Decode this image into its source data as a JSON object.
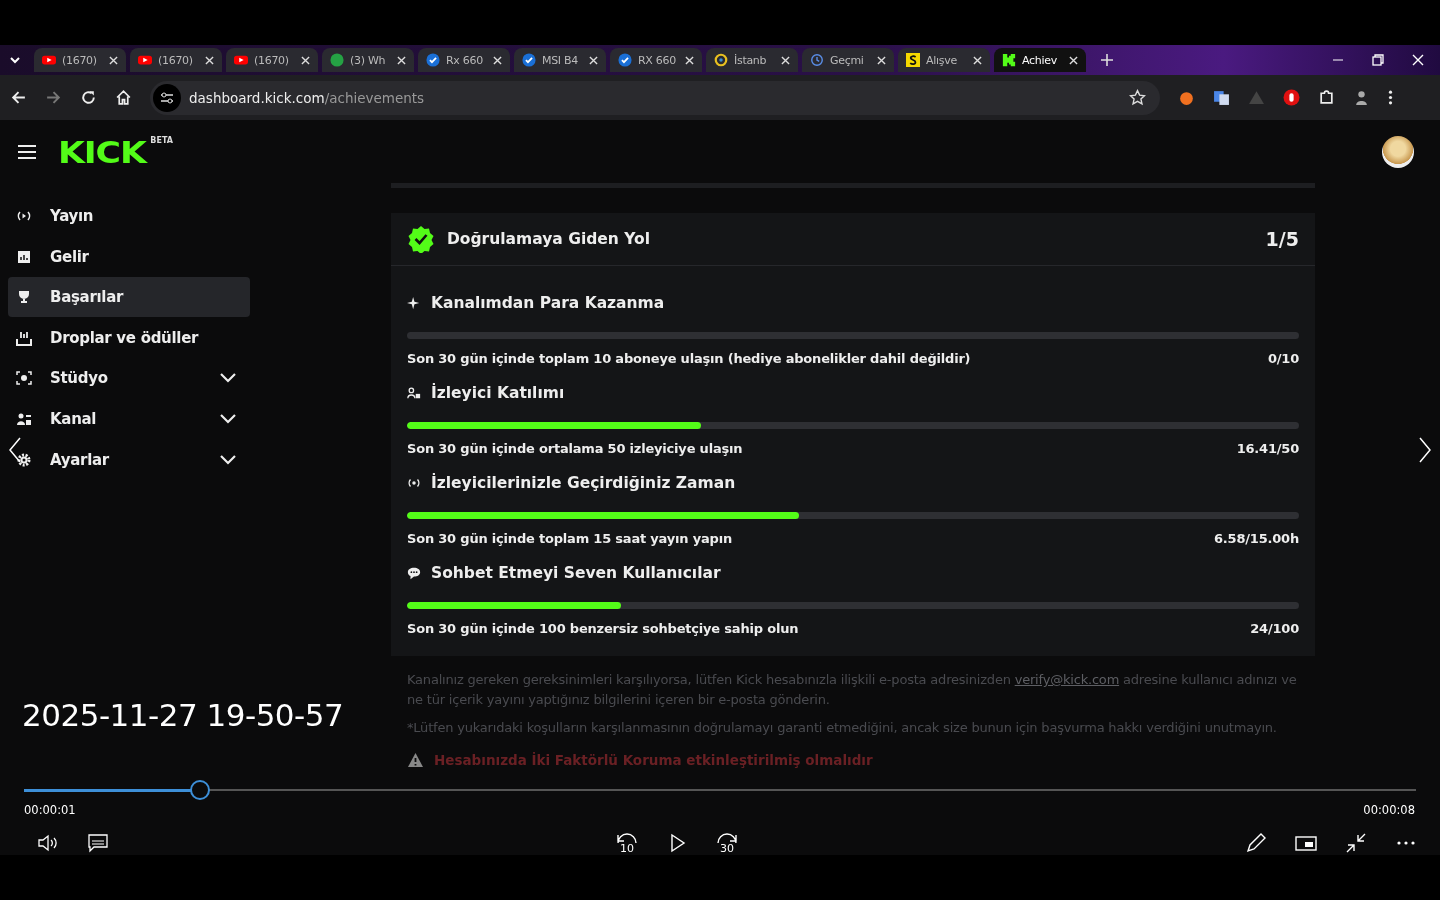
{
  "browser": {
    "tabs": [
      {
        "kind": "youtube",
        "label": "(1670)",
        "selected": false
      },
      {
        "kind": "youtube",
        "label": "(1670)",
        "selected": false
      },
      {
        "kind": "youtube",
        "label": "(1670)",
        "selected": false
      },
      {
        "kind": "whatsapp",
        "label": "(3) Wh",
        "selected": false
      },
      {
        "kind": "check",
        "label": "Rx 660",
        "selected": false
      },
      {
        "kind": "check",
        "label": "MSI B4",
        "selected": false
      },
      {
        "kind": "check",
        "label": "RX 660",
        "selected": false
      },
      {
        "kind": "ring",
        "label": "İstanb",
        "selected": false
      },
      {
        "kind": "history",
        "label": "Geçmi",
        "selected": false
      },
      {
        "kind": "s",
        "label": "Alışve",
        "selected": false
      },
      {
        "kind": "kick",
        "label": "Achiev",
        "selected": true
      }
    ],
    "url_host": "dashboard.kick.com",
    "url_path": "/achievements"
  },
  "logo": {
    "text": "KICK",
    "badge": "BETA"
  },
  "sidebar": {
    "items": [
      {
        "kind": "broadcast",
        "label": "Yayın",
        "selected": false,
        "expandable": false
      },
      {
        "kind": "chart",
        "label": "Gelir",
        "selected": false,
        "expandable": false
      },
      {
        "kind": "trophy",
        "label": "Başarılar",
        "selected": true,
        "expandable": false
      },
      {
        "kind": "drops",
        "label": "Droplar ve ödüller",
        "selected": false,
        "expandable": false
      },
      {
        "kind": "studio",
        "label": "Stüdyo",
        "selected": false,
        "expandable": true
      },
      {
        "kind": "channel",
        "label": "Kanal",
        "selected": false,
        "expandable": true
      },
      {
        "kind": "settings",
        "label": "Ayarlar",
        "selected": false,
        "expandable": true
      }
    ]
  },
  "card": {
    "title": "Doğrulamaya Giden Yol",
    "progress": "1/5",
    "goals": [
      {
        "kind": "sparkle",
        "title": "Kanalımdan Para Kazanma",
        "level": 0,
        "description": "Son 30 gün içinde toplam 10 aboneye ulaşın (hediye abonelikler dahil değildir)",
        "value": "0/10"
      },
      {
        "kind": "viewers",
        "title": "İzleyici Katılımı",
        "level": 0.33,
        "description": "Son 30 gün içinde ortalama 50 izleyiciye ulaşın",
        "value": "16.41/50"
      },
      {
        "kind": "broadcast",
        "title": "İzleyicilerinizle Geçirdiğiniz Zaman",
        "level": 0.44,
        "description": "Son 30 gün içinde toplam 15 saat yayın yapın",
        "value": "6.58/15.00h"
      },
      {
        "kind": "chat",
        "title": "Sohbet Etmeyi Seven Kullanıcılar",
        "level": 0.24,
        "description": "Son 30 gün içinde 100 benzersiz sohbetçiye sahip olun",
        "value": "24/100"
      }
    ],
    "note_before": "Kanalınız gereken gereksinimleri karşılıyorsa, lütfen Kick hesabınızla ilişkili e-posta adresinizden",
    "note_link": "verify@kick.com",
    "note_after": "adresine kullanıcı adınızı ve ne tür içerik yayını yaptığınız bilgilerini içeren bir e-posta gönderin.",
    "disclaimer": "*Lütfen yukarıdaki koşulların karşılanmasının doğrulamayı garanti etmediğini, ancak size bunun için başvurma hakkı verdiğini unutmayın.",
    "warning": "Hesabınızda İki Faktörlü Koruma etkinleştirilmiş olmalıdır"
  },
  "player": {
    "title": "2025-11-27 19-50-57",
    "level": 0.125,
    "elapsed": "00:00:01",
    "duration": "00:00:08",
    "skip_back": "10",
    "skip_forward": "30"
  }
}
